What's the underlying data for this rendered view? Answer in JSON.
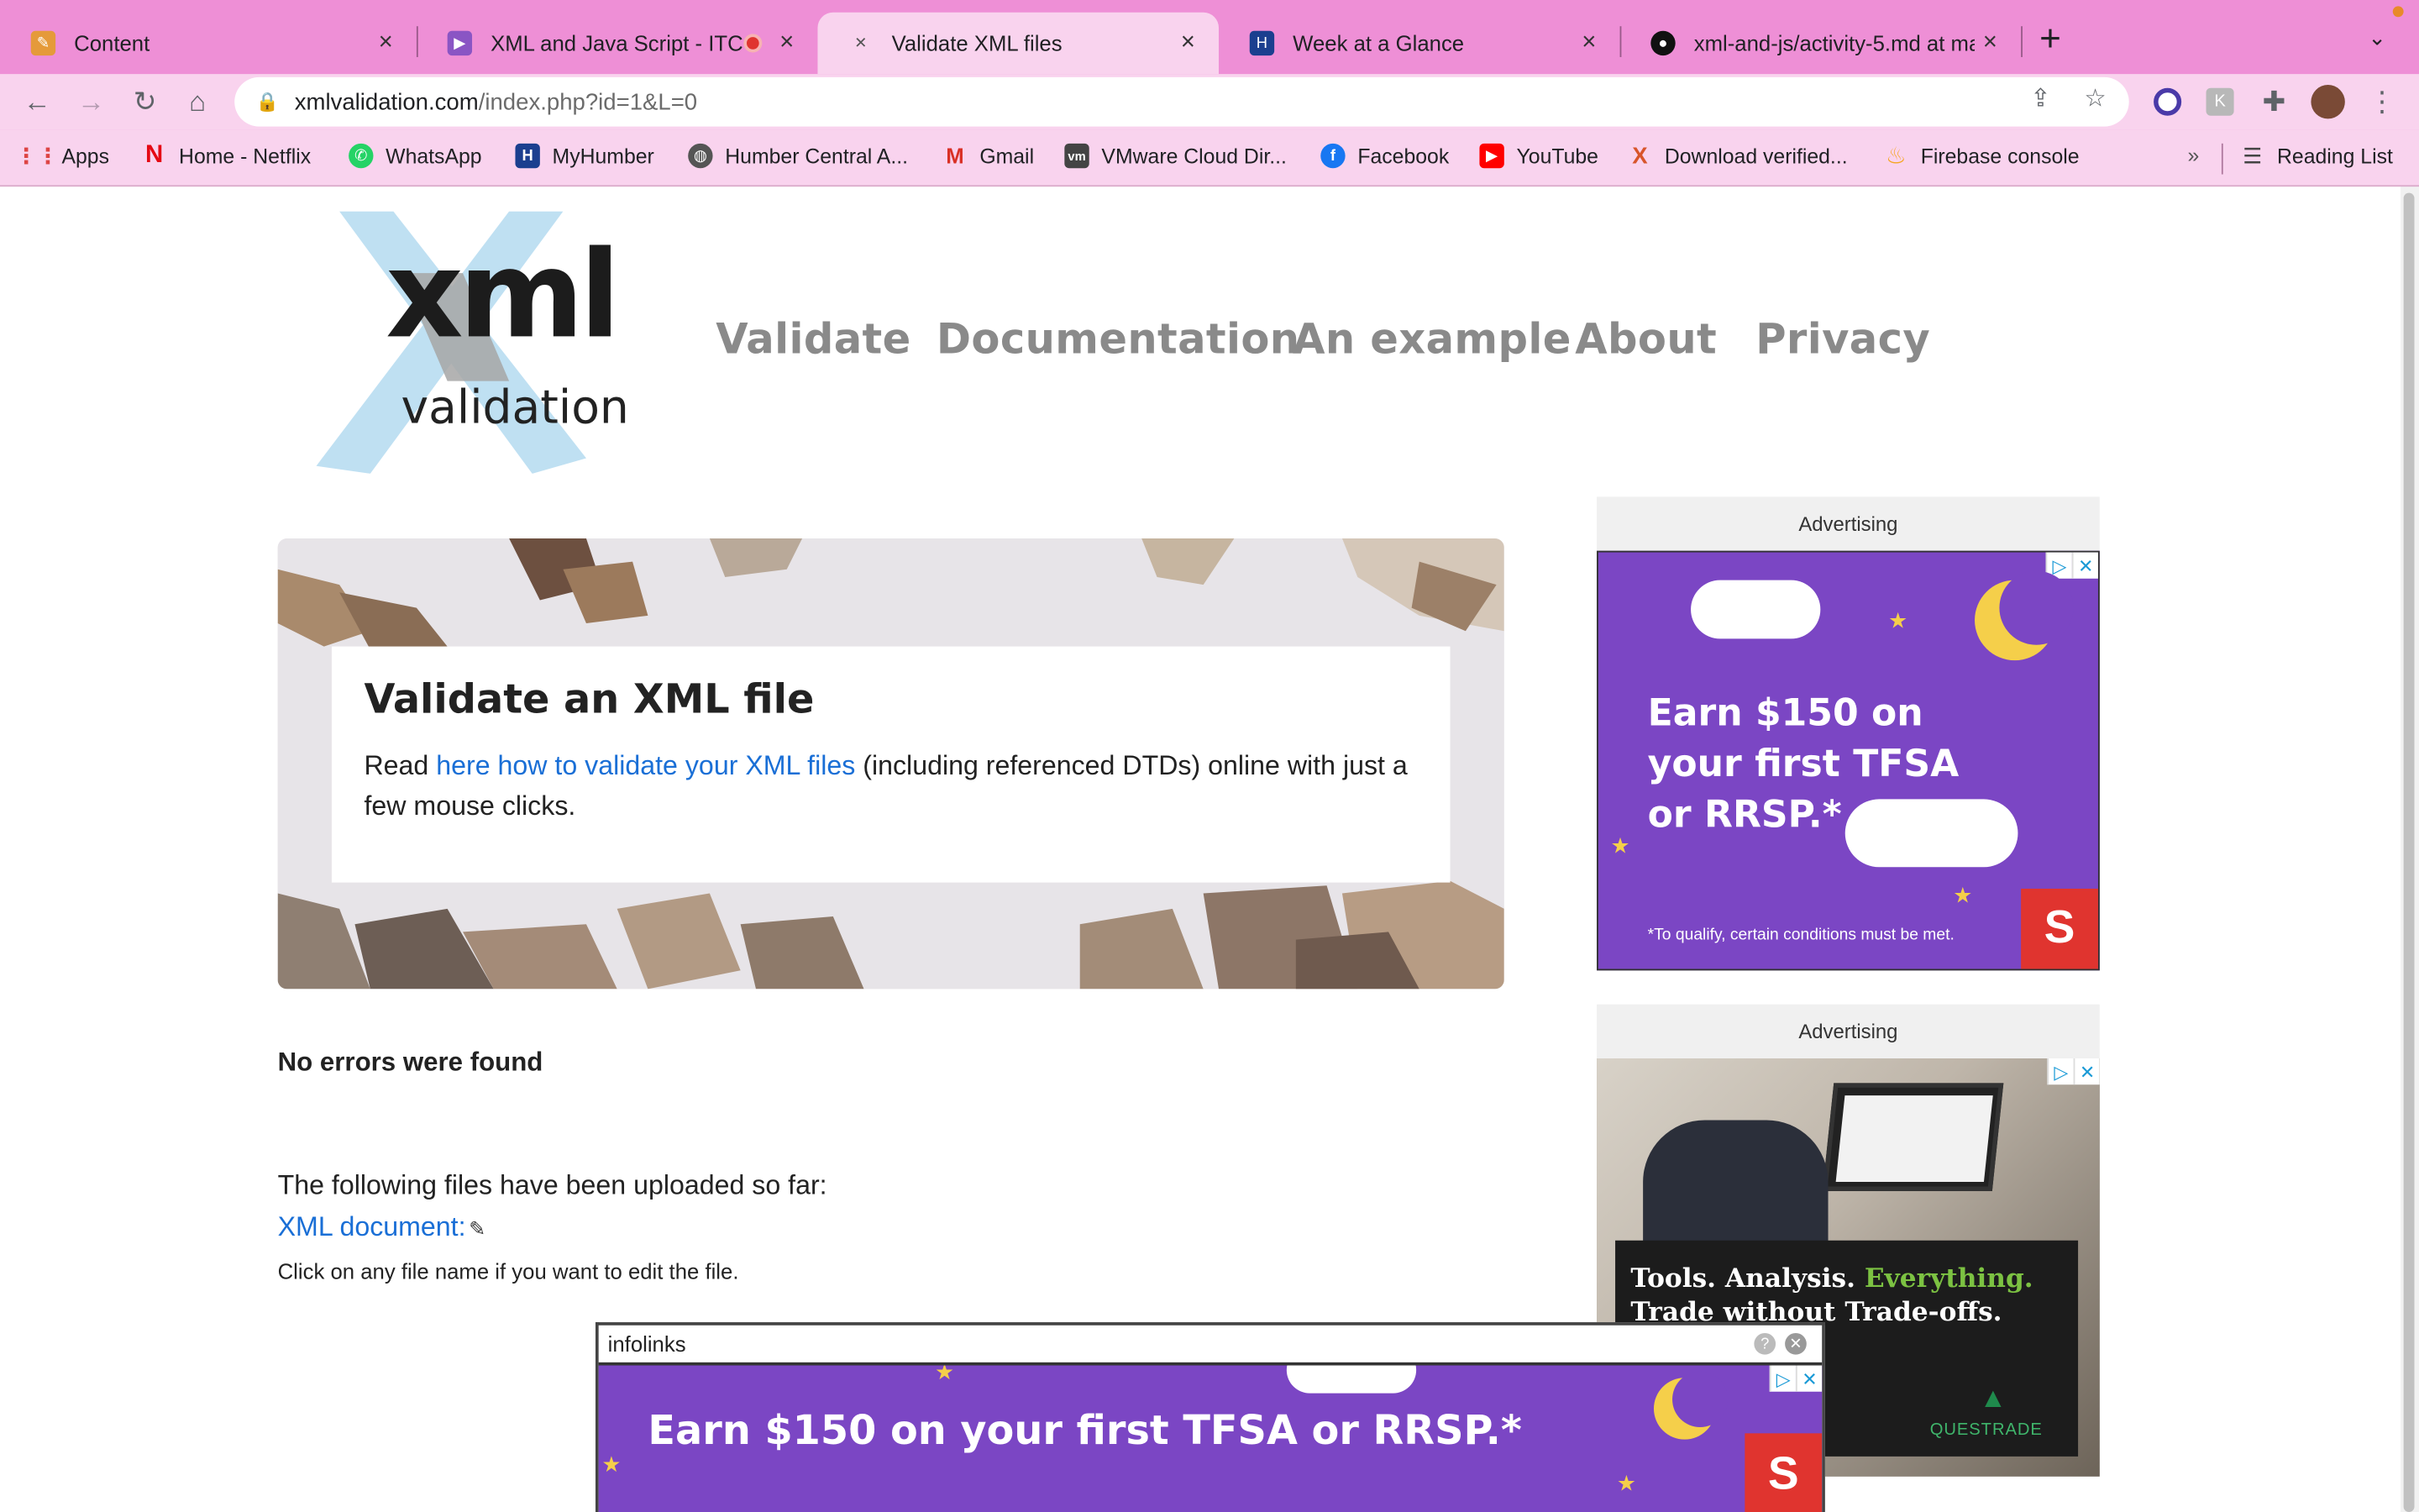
{
  "tabs": [
    {
      "title": "Content",
      "icon": "pencil-icon",
      "color": "#e59a3a"
    },
    {
      "title": "XML and Java Script - ITC-",
      "icon": "play-icon",
      "color": "#8a55c4"
    },
    {
      "title": "Validate XML files",
      "icon": "xml-icon",
      "color": "#555555"
    },
    {
      "title": "Week at a Glance",
      "icon": "humber-icon",
      "color": "#1b3f8f"
    },
    {
      "title": "xml-and-js/activity-5.md at ma",
      "icon": "github-icon",
      "color": "#111111"
    }
  ],
  "address": {
    "host": "xmlvalidation.com",
    "path": "/index.php?id=1&L=0"
  },
  "bookmarks": [
    {
      "label": "Apps",
      "icon": "apps-grid-icon"
    },
    {
      "label": "Home - Netflix",
      "icon": "netflix-icon"
    },
    {
      "label": "WhatsApp",
      "icon": "whatsapp-icon"
    },
    {
      "label": "MyHumber",
      "icon": "humber-icon"
    },
    {
      "label": "Humber Central A...",
      "icon": "globe-icon"
    },
    {
      "label": "Gmail",
      "icon": "gmail-icon"
    },
    {
      "label": "VMware Cloud Dir...",
      "icon": "vmware-icon"
    },
    {
      "label": "Facebook",
      "icon": "facebook-icon"
    },
    {
      "label": "YouTube",
      "icon": "youtube-icon"
    },
    {
      "label": "Download verified...",
      "icon": "x-brand-icon"
    },
    {
      "label": "Firebase console",
      "icon": "firebase-icon"
    }
  ],
  "reading_list": "Reading List",
  "site": {
    "logo_main": "xml",
    "logo_sub": "validation",
    "nav": [
      "Validate",
      "Documentation",
      "An example",
      "About",
      "Privacy"
    ]
  },
  "hero": {
    "title": "Validate an XML file",
    "text_pre": "Read ",
    "link": "here how to validate your XML files",
    "text_post": " (including referenced DTDs) online with just a few mouse clicks."
  },
  "result": "No errors were found",
  "uploaded_intro": "The following files have been uploaded so far:",
  "xml_document": "XML document:",
  "click_hint": "Click on any file name if you want to edit the file.",
  "ads": {
    "label": "Advertising",
    "ad1_headline": [
      "Earn $150 on",
      "your first TFSA",
      "or RRSP.*"
    ],
    "ad1_footnote": "*To qualify, certain conditions must be met.",
    "ad2_line1_a": "Tools. Analysis. ",
    "ad2_line1_b": "Everything.",
    "ad2_line2": "Trade without Trade-offs.",
    "ad2_brand": "QUESTRADE",
    "popup_brand": "infolinks",
    "popup_headline": "Earn $150 on your first TFSA or RRSP.*"
  },
  "colors": {
    "tabstrip": "#ee8fd6",
    "toolbar": "#f9d3ee",
    "ad_purple": "#7b46c4",
    "link": "#1a6fd6",
    "nav": "#8a8a8a"
  }
}
